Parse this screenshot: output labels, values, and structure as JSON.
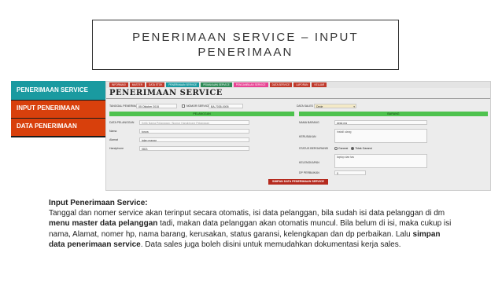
{
  "slide": {
    "title_line1": "PENERIMAAN SERVICE – INPUT",
    "title_line2": "PENERIMAAN"
  },
  "sidebar": {
    "items": [
      {
        "label": "PENERIMAAN SERVICE",
        "color": "#1a9aa0"
      },
      {
        "label": "INPUT PENERIMAAN",
        "color": "#d8400c"
      },
      {
        "label": "DATA PENERIMAAN",
        "color": "#d8400c"
      }
    ]
  },
  "app": {
    "nav": [
      {
        "label": "INFORMASI",
        "color": "#c0392b"
      },
      {
        "label": "MASTER",
        "color": "#c0392b"
      },
      {
        "label": "DATA STOK",
        "color": "#c0392b"
      },
      {
        "label": "PENERIMAAN SERVICE",
        "color": "#1a9aa0"
      },
      {
        "label": "PEMAKAIAN SERVICE",
        "color": "#2e8b57"
      },
      {
        "label": "PENGAMBILAN SERVICE",
        "color": "#e84393"
      },
      {
        "label": "DATA SERVICE",
        "color": "#c0392b"
      },
      {
        "label": "LAPORAN",
        "color": "#c0392b"
      },
      {
        "label": "KELUAR",
        "color": "#c0392b"
      }
    ],
    "page_title": "PENERIMAAN SERVICE",
    "tanggal_label": "TANGGAL PENERIMAAN",
    "tanggal_value": "05 Oktober 2015",
    "nomor_label": "NOMOR SERVICE",
    "nomor_value": "BA-7035-0005",
    "data_sales_label": "DATA SALES",
    "data_sales_value": "Dede",
    "section_left": "PELANGGAN",
    "section_right": "BARANG",
    "data_pelanggan_label": "DATA PELANGGAN",
    "data_pelanggan_placeholder": "Ketik Nama Pelanggan / Nomor Handphone Pelanggan",
    "nama_label": "Nama",
    "nama_value": "tonya",
    "alamat_label": "Alamat",
    "alamat_value": "jalan mawar",
    "handphone_label": "Handphone",
    "handphone_value": "0821",
    "nama_barang_label": "NAMA BARANG",
    "nama_barang_value": "desk mg",
    "kerusakan_label": "KERUSAKAN",
    "kerusakan_value": "install ulang",
    "status_garansi_label": "STATUS BERGARANSI",
    "garansi_opt1": "Garansi",
    "garansi_opt2": "Tidak Garansi",
    "kelengkapan_label": "KELENGKAPAN",
    "kelengkapan_value": "laptop dan tas",
    "dp_label": "DP PERBAIKAN",
    "dp_value": "0",
    "save_button": "SIMPAN DATA PENERIMAAN SERVICE"
  },
  "description": {
    "heading": "Input Penerimaan Service:",
    "p1": "Tanggal dan nomer service akan terinput secara otomatis, isi data pelanggan, bila sudah isi data pelanggan di dm ",
    "b1": "menu master data pelanggan",
    "p2": " tadi, makan data pelanggan akan otomatis muncul. Bila belum di isi, maka cukup isi nama, Alamat, nomer hp, nama barang, kerusakan, status garansi, kelengkapan dan dp perbaikan. Lalu ",
    "b2": "simpan data penerimaan service",
    "p3": ". Data sales juga boleh disini untuk memudahkan dokumentasi kerja sales."
  }
}
